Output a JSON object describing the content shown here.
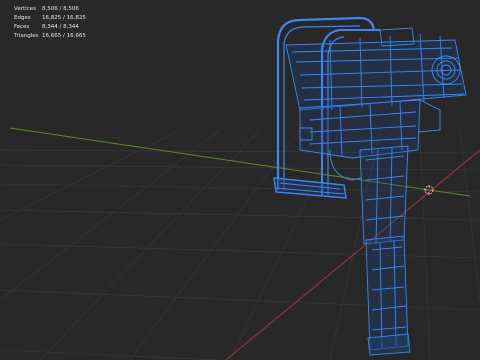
{
  "stats": {
    "vertices_label": "Vertices",
    "vertices_value": "8,506 / 8,506",
    "edges_label": "Edges",
    "edges_value": "16,825 / 16,825",
    "faces_label": "Faces",
    "faces_value": "8,344 / 8,344",
    "triangles_label": "Triangles",
    "triangles_value": "16,665 / 16,665"
  },
  "colors": {
    "background": "#282828",
    "grid": "#3a3a3a",
    "x_axis": "#9a3a44",
    "y_axis": "#5e8a2c",
    "wireframe": "#3d8cff",
    "wireframe_fill": "#1a4a8a"
  },
  "icons": {
    "cursor": "3d-cursor-icon",
    "model": "smg-wireframe-mesh"
  }
}
